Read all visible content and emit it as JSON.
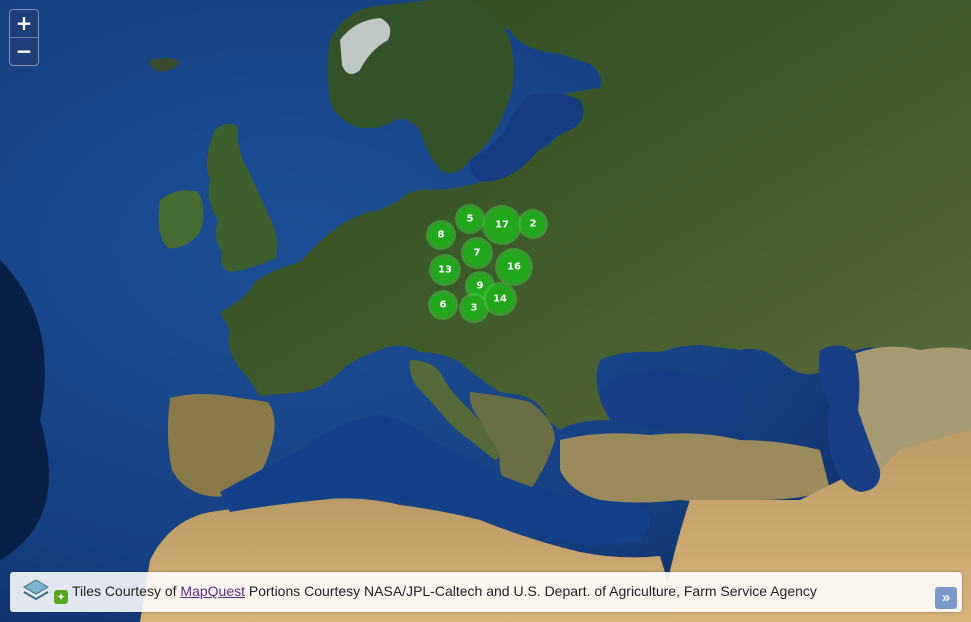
{
  "zoom": {
    "in_label": "+",
    "out_label": "−"
  },
  "clusters": [
    {
      "count": "5"
    },
    {
      "count": "17"
    },
    {
      "count": "2"
    },
    {
      "count": "8"
    },
    {
      "count": "7"
    },
    {
      "count": "13"
    },
    {
      "count": "16"
    },
    {
      "count": "9"
    },
    {
      "count": "6"
    },
    {
      "count": "3"
    },
    {
      "count": "14"
    }
  ],
  "attribution": {
    "prefix": "Tiles Courtesy of",
    "link": "MapQuest",
    "suffix": "Portions Courtesy NASA/JPL-Caltech and U.S. Depart. of Agriculture, Farm Service Agency",
    "expand_label": "»"
  },
  "colors": {
    "cluster_fill": "#22a81c",
    "cluster_halo": "#3cc93a",
    "ocean": "#143c82",
    "land": "#3e5a26",
    "desert": "#c8a46a"
  }
}
